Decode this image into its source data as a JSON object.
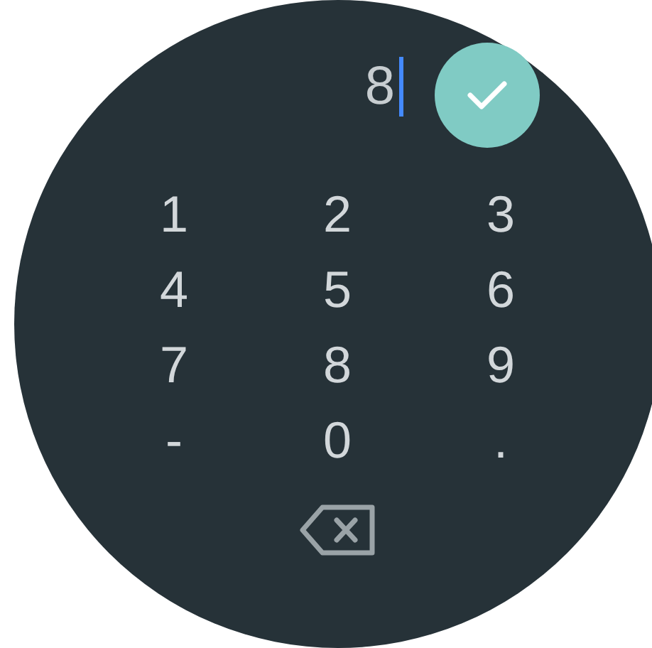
{
  "input": {
    "value": "8",
    "focused": true
  },
  "keys": [
    "1",
    "2",
    "3",
    "4",
    "5",
    "6",
    "7",
    "8",
    "9",
    "-",
    "0",
    "."
  ]
}
